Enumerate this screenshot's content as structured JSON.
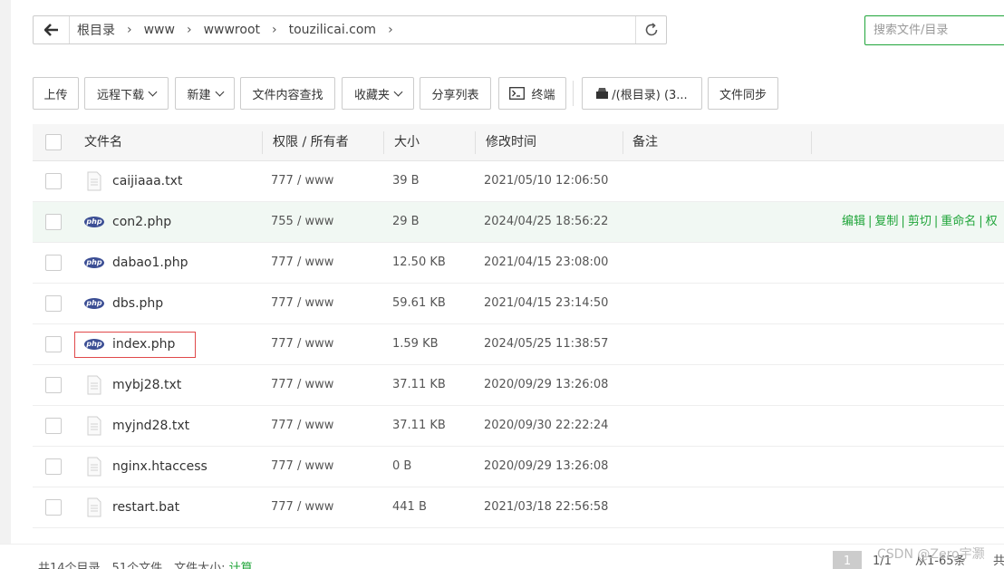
{
  "address": {
    "crumbs": [
      "根目录",
      "www",
      "wwwroot",
      "touzilicai.com"
    ]
  },
  "search": {
    "placeholder": "搜索文件/目录"
  },
  "toolbar": {
    "upload": "上传",
    "remote_download": "远程下载",
    "new": "新建",
    "content_search": "文件内容查找",
    "favorites": "收藏夹",
    "share_list": "分享列表",
    "terminal": "终端",
    "disk": "/(根目录) (3...",
    "file_sync": "文件同步"
  },
  "table": {
    "headers": [
      "文件名",
      "权限 / 所有者",
      "大小",
      "修改时间",
      "备注"
    ],
    "rows": [
      {
        "name": "caijiaaa.txt",
        "perm": "777 / www",
        "size": "39 B",
        "mtime": "2021/05/10 12:06:50",
        "type": "file"
      },
      {
        "name": "con2.php",
        "perm": "755 / www",
        "size": "29 B",
        "mtime": "2024/04/25 18:56:22",
        "type": "php"
      },
      {
        "name": "dabao1.php",
        "perm": "777 / www",
        "size": "12.50 KB",
        "mtime": "2021/04/15 23:08:00",
        "type": "php"
      },
      {
        "name": "dbs.php",
        "perm": "777 / www",
        "size": "59.61 KB",
        "mtime": "2021/04/15 23:14:50",
        "type": "php"
      },
      {
        "name": "index.php",
        "perm": "777 / www",
        "size": "1.59 KB",
        "mtime": "2024/05/25 11:38:57",
        "type": "php"
      },
      {
        "name": "mybj28.txt",
        "perm": "777 / www",
        "size": "37.11 KB",
        "mtime": "2020/09/29 13:26:08",
        "type": "file"
      },
      {
        "name": "myjnd28.txt",
        "perm": "777 / www",
        "size": "37.11 KB",
        "mtime": "2020/09/30 22:22:24",
        "type": "file"
      },
      {
        "name": "nginx.htaccess",
        "perm": "777 / www",
        "size": "0 B",
        "mtime": "2020/09/29 13:26:08",
        "type": "file"
      },
      {
        "name": "restart.bat",
        "perm": "777 / www",
        "size": "441 B",
        "mtime": "2021/03/18 22:56:58",
        "type": "file"
      }
    ],
    "row_ops": [
      "编辑",
      "复制",
      "剪切",
      "重命名",
      "权"
    ]
  },
  "footer": {
    "summary": "共14个目录，51个文件，文件大小:",
    "calc": "计算",
    "page_current": "1",
    "page_total": "1/1",
    "range": "从1-65条",
    "total": "共"
  },
  "watermark": "CSDN @Zero宇灏",
  "colors": {
    "accent": "#20a53a",
    "php_icon": "#3b4e94",
    "highlight": "#e0494a"
  }
}
